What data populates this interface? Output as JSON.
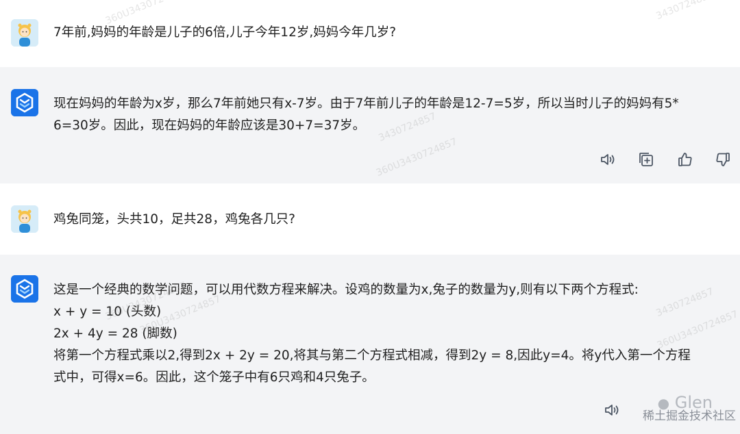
{
  "conversation": [
    {
      "role": "user",
      "avatar_icon": "cartoon-girl-avatar",
      "lines": [
        "7年前,妈妈的年龄是儿子的6倍,儿子今年12岁,妈妈今年几岁?"
      ]
    },
    {
      "role": "assistant",
      "avatar_icon": "assistant-logo-icon",
      "lines": [
        "现在妈妈的年龄为x岁，那么7年前她只有x-7岁。由于7年前儿子的年龄是12-7=5岁，所以当时儿子的妈妈有5*",
        "6=30岁。因此，现在妈妈的年龄应该是30+7=37岁。"
      ],
      "actions": [
        "speaker-icon",
        "copy-icon",
        "thumbs-up-icon",
        "thumbs-down-icon"
      ]
    },
    {
      "role": "user",
      "avatar_icon": "cartoon-girl-avatar",
      "lines": [
        "鸡兔同笼，头共10，足共28，鸡兔各几只?"
      ]
    },
    {
      "role": "assistant",
      "avatar_icon": "assistant-logo-icon",
      "lines": [
        "这是一个经典的数学问题，可以用代数方程来解决。设鸡的数量为x,兔子的数量为y,则有以下两个方程式:",
        "x + y = 10 (头数)",
        "2x + 4y = 28 (脚数)",
        "将第一个方程式乘以2,得到2x + 2y = 20,将其与第二个方程式相减，得到2y = 8,因此y=4。将y代入第一个方程",
        "式中，可得x=6。因此，这个笼子中有6只鸡和4只兔子。"
      ]
    }
  ],
  "watermarks": [
    "360U3430724857",
    "3430724857",
    "360U3430724857",
    "3430724857",
    "360U3430724857",
    "3430724857",
    "360U3430724857",
    "360U3430724857"
  ],
  "brand": {
    "handle": "Glen",
    "community": "稀土掘金技术社区"
  },
  "colors": {
    "user_bg": "#ffffff",
    "assistant_bg": "#f3f4f6",
    "assistant_logo": "#1a73e8",
    "text": "#1f1f1f",
    "icon": "#4b5563"
  }
}
